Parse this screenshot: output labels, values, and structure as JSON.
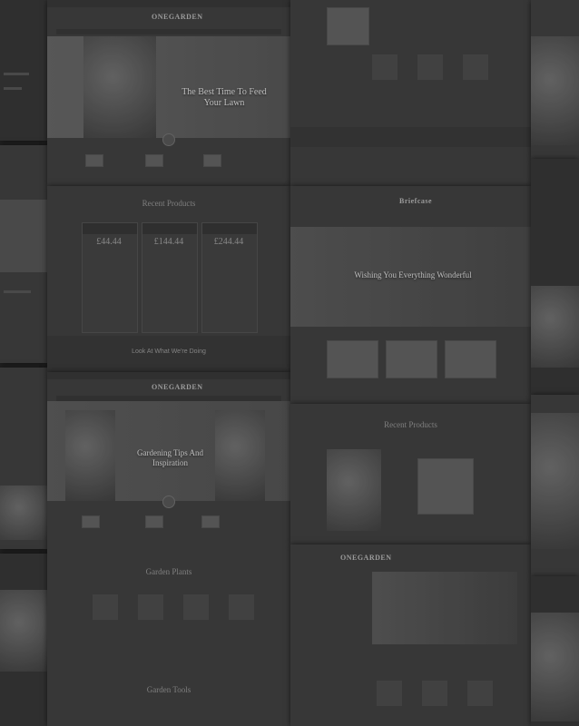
{
  "site": {
    "logo_one": "ONEGARDEN",
    "logo_two": "Briefcase",
    "logo_three": "ONEGARDEN"
  },
  "panels": {
    "hero_main": "The Best Time To Feed Your Lawn",
    "recent_products": "Recent Products",
    "prices": [
      "£44.44",
      "£144.44",
      "£244.44"
    ],
    "look_title": "Look At What We're Doing",
    "hero_tips": "Gardening Tips And Inspiration",
    "garden_plants": "Garden Plants",
    "garden_tools": "Garden Tools",
    "briefcase_hero": "Wishing You Everything Wonderful",
    "recent_products_2": "Recent Products"
  }
}
